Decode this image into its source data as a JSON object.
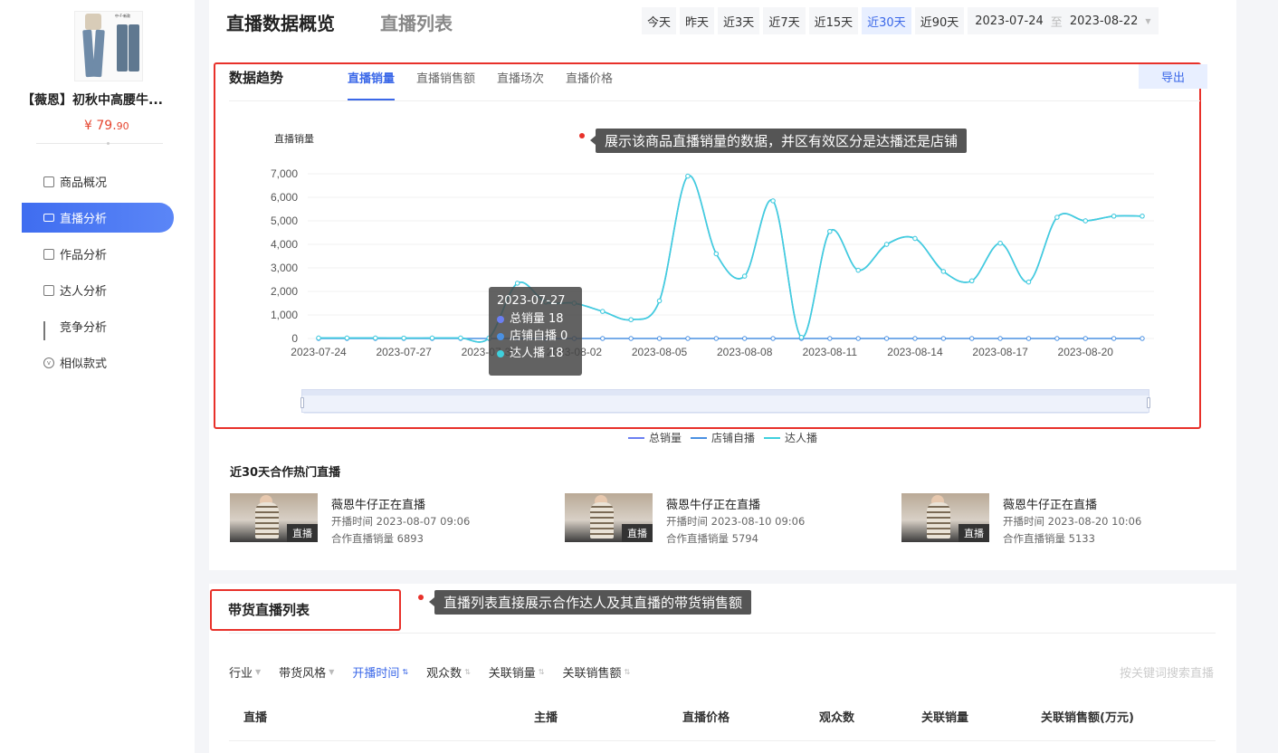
{
  "product": {
    "title": "【薇恩】初秋中高腰牛...",
    "price_symbol": "¥",
    "price_int": "79.",
    "price_dec": "90",
    "thumb_text": "中-F-新款"
  },
  "sidebar": {
    "items": [
      {
        "label": "商品概况",
        "icon": "document-icon"
      },
      {
        "label": "直播分析",
        "icon": "live-icon"
      },
      {
        "label": "作品分析",
        "icon": "video-doc-icon"
      },
      {
        "label": "达人分析",
        "icon": "person-card-icon"
      },
      {
        "label": "竞争分析",
        "icon": "bar-chart-icon"
      },
      {
        "label": "相似款式",
        "icon": "similar-icon"
      }
    ],
    "active_index": 1
  },
  "header": {
    "title": "直播数据概览",
    "subtitle": "直播列表",
    "ranges": [
      "今天",
      "昨天",
      "近3天",
      "近7天",
      "近15天",
      "近30天",
      "近90天"
    ],
    "active_range": "近30天",
    "date_start": "2023-07-24",
    "date_sep": "至",
    "date_end": "2023-08-22"
  },
  "trend": {
    "title": "数据趋势",
    "tabs": [
      "直播销量",
      "直播销售额",
      "直播场次",
      "直播价格"
    ],
    "active_tab": "直播销量",
    "export_label": "导出",
    "callout": "展示该商品直播销量的数据，并区有效区分是达播还是店铺"
  },
  "tooltip": {
    "date": "2023-07-27",
    "rows": [
      {
        "label": "总销量",
        "value": "18",
        "color": "#6b7ff2"
      },
      {
        "label": "店铺自播",
        "value": "0",
        "color": "#4a90e2"
      },
      {
        "label": "达人播",
        "value": "18",
        "color": "#3fd0dd"
      }
    ]
  },
  "chart_data": {
    "type": "line",
    "ylabel": "直播销量",
    "ylim": [
      0,
      7000
    ],
    "yticks": [
      "0",
      "1,000",
      "2,000",
      "3,000",
      "4,000",
      "5,000",
      "6,000",
      "7,000"
    ],
    "x": [
      "2023-07-24",
      "2023-07-25",
      "2023-07-26",
      "2023-07-27",
      "2023-07-28",
      "2023-07-29",
      "2023-07-30",
      "2023-07-31",
      "2023-08-01",
      "2023-08-02",
      "2023-08-03",
      "2023-08-04",
      "2023-08-05",
      "2023-08-06",
      "2023-08-07",
      "2023-08-08",
      "2023-08-09",
      "2023-08-10",
      "2023-08-11",
      "2023-08-12",
      "2023-08-13",
      "2023-08-14",
      "2023-08-15",
      "2023-08-16",
      "2023-08-17",
      "2023-08-18",
      "2023-08-19",
      "2023-08-20",
      "2023-08-21",
      "2023-08-22"
    ],
    "xtick_labels": [
      "2023-07-24",
      "2023-07-27",
      "2023-07-30",
      "2023-08-02",
      "2023-08-05",
      "2023-08-08",
      "2023-08-11",
      "2023-08-14",
      "2023-08-17",
      "2023-08-20"
    ],
    "series": [
      {
        "name": "总销量",
        "color": "#6b7ff2",
        "values": [
          20,
          20,
          20,
          18,
          20,
          20,
          20,
          2350,
          1550,
          1500,
          1150,
          800,
          1600,
          6900,
          3600,
          2650,
          5850,
          50,
          4550,
          2900,
          4000,
          4250,
          2850,
          2450,
          4050,
          2400,
          5150,
          5000,
          5200,
          5200
        ]
      },
      {
        "name": "店铺自播",
        "color": "#4a90e2",
        "values": [
          0,
          0,
          0,
          0,
          0,
          0,
          0,
          0,
          0,
          0,
          0,
          0,
          0,
          0,
          0,
          0,
          0,
          0,
          0,
          0,
          0,
          0,
          0,
          0,
          0,
          0,
          0,
          0,
          0,
          0
        ]
      },
      {
        "name": "达人播",
        "color": "#3fd0dd",
        "values": [
          20,
          20,
          20,
          18,
          20,
          20,
          20,
          2350,
          1550,
          1500,
          1150,
          800,
          1600,
          6900,
          3600,
          2650,
          5850,
          50,
          4550,
          2900,
          4000,
          4250,
          2850,
          2450,
          4050,
          2400,
          5150,
          5000,
          5200,
          5200
        ]
      }
    ],
    "legend_position": "bottom"
  },
  "hot": {
    "title": "近30天合作热门直播",
    "cards": [
      {
        "title": "薇恩牛仔正在直播",
        "time_label": "开播时间",
        "time": "2023-08-07 09:06",
        "sales_label": "合作直播销量",
        "sales": "6893",
        "tag": "直播"
      },
      {
        "title": "薇恩牛仔正在直播",
        "time_label": "开播时间",
        "time": "2023-08-10 09:06",
        "sales_label": "合作直播销量",
        "sales": "5794",
        "tag": "直播"
      },
      {
        "title": "薇恩牛仔正在直播",
        "time_label": "开播时间",
        "time": "2023-08-20 10:06",
        "sales_label": "合作直播销量",
        "sales": "5133",
        "tag": "直播"
      }
    ]
  },
  "list": {
    "title": "带货直播列表",
    "callout": "直播列表直接展示合作达人及其直播的带货销售额",
    "filters": [
      "行业",
      "带货风格",
      "开播时间",
      "观众数",
      "关联销量",
      "关联销售额"
    ],
    "active_filter": "开播时间",
    "search_placeholder": "按关键词搜索直播",
    "columns": [
      "直播",
      "主播",
      "直播价格",
      "观众数",
      "关联销量",
      "关联销售额(万元)"
    ]
  }
}
